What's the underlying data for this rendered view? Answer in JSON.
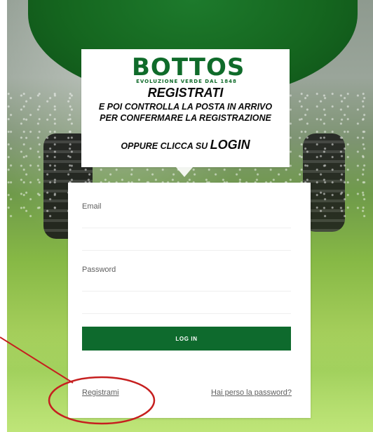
{
  "brand": {
    "name": "BOTTOS",
    "tagline": "EVOLUZIONE VERDE DAL 1848",
    "color": "#0f6b2a"
  },
  "notice": {
    "title": "REGISTRATI",
    "line1": "E POI CONTROLLA LA POSTA IN ARRIVO",
    "line2": "PER CONFERMARE LA REGISTRAZIONE",
    "or_prefix": "OPPURE CLICCA SU ",
    "or_action": "LOGIN"
  },
  "form": {
    "email_label": "Email",
    "email_value": "",
    "email_placeholder": "",
    "password_label": "Password",
    "password_value": "",
    "password_placeholder": "",
    "submit_label": "LOG IN",
    "register_link": "Registrami",
    "forgot_link": "Hai perso la password?"
  },
  "annotation": {
    "shape": "red-ellipse-with-callout-line",
    "color": "#c61f1f"
  }
}
